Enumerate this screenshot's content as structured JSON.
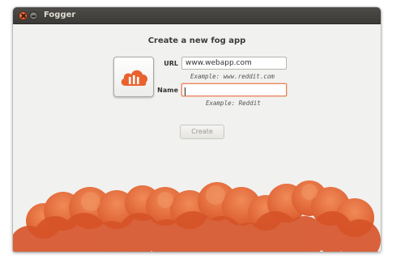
{
  "window": {
    "title": "Fogger",
    "close_icon": "close-icon",
    "minimize_icon": "minimize-icon"
  },
  "form": {
    "heading": "Create a new fog app",
    "app_icon": "fogger-cloud-icon",
    "url_label": "URL",
    "url_value": "www.webapp.com",
    "url_hint": "Example: www.reddit.com",
    "name_label": "Name",
    "name_value": "",
    "name_hint": "Example: Reddit",
    "create_label": "Create"
  },
  "colors": {
    "accent": "#e9622e",
    "cloud": "#e8703d",
    "titlebar": "#3c3b37"
  }
}
